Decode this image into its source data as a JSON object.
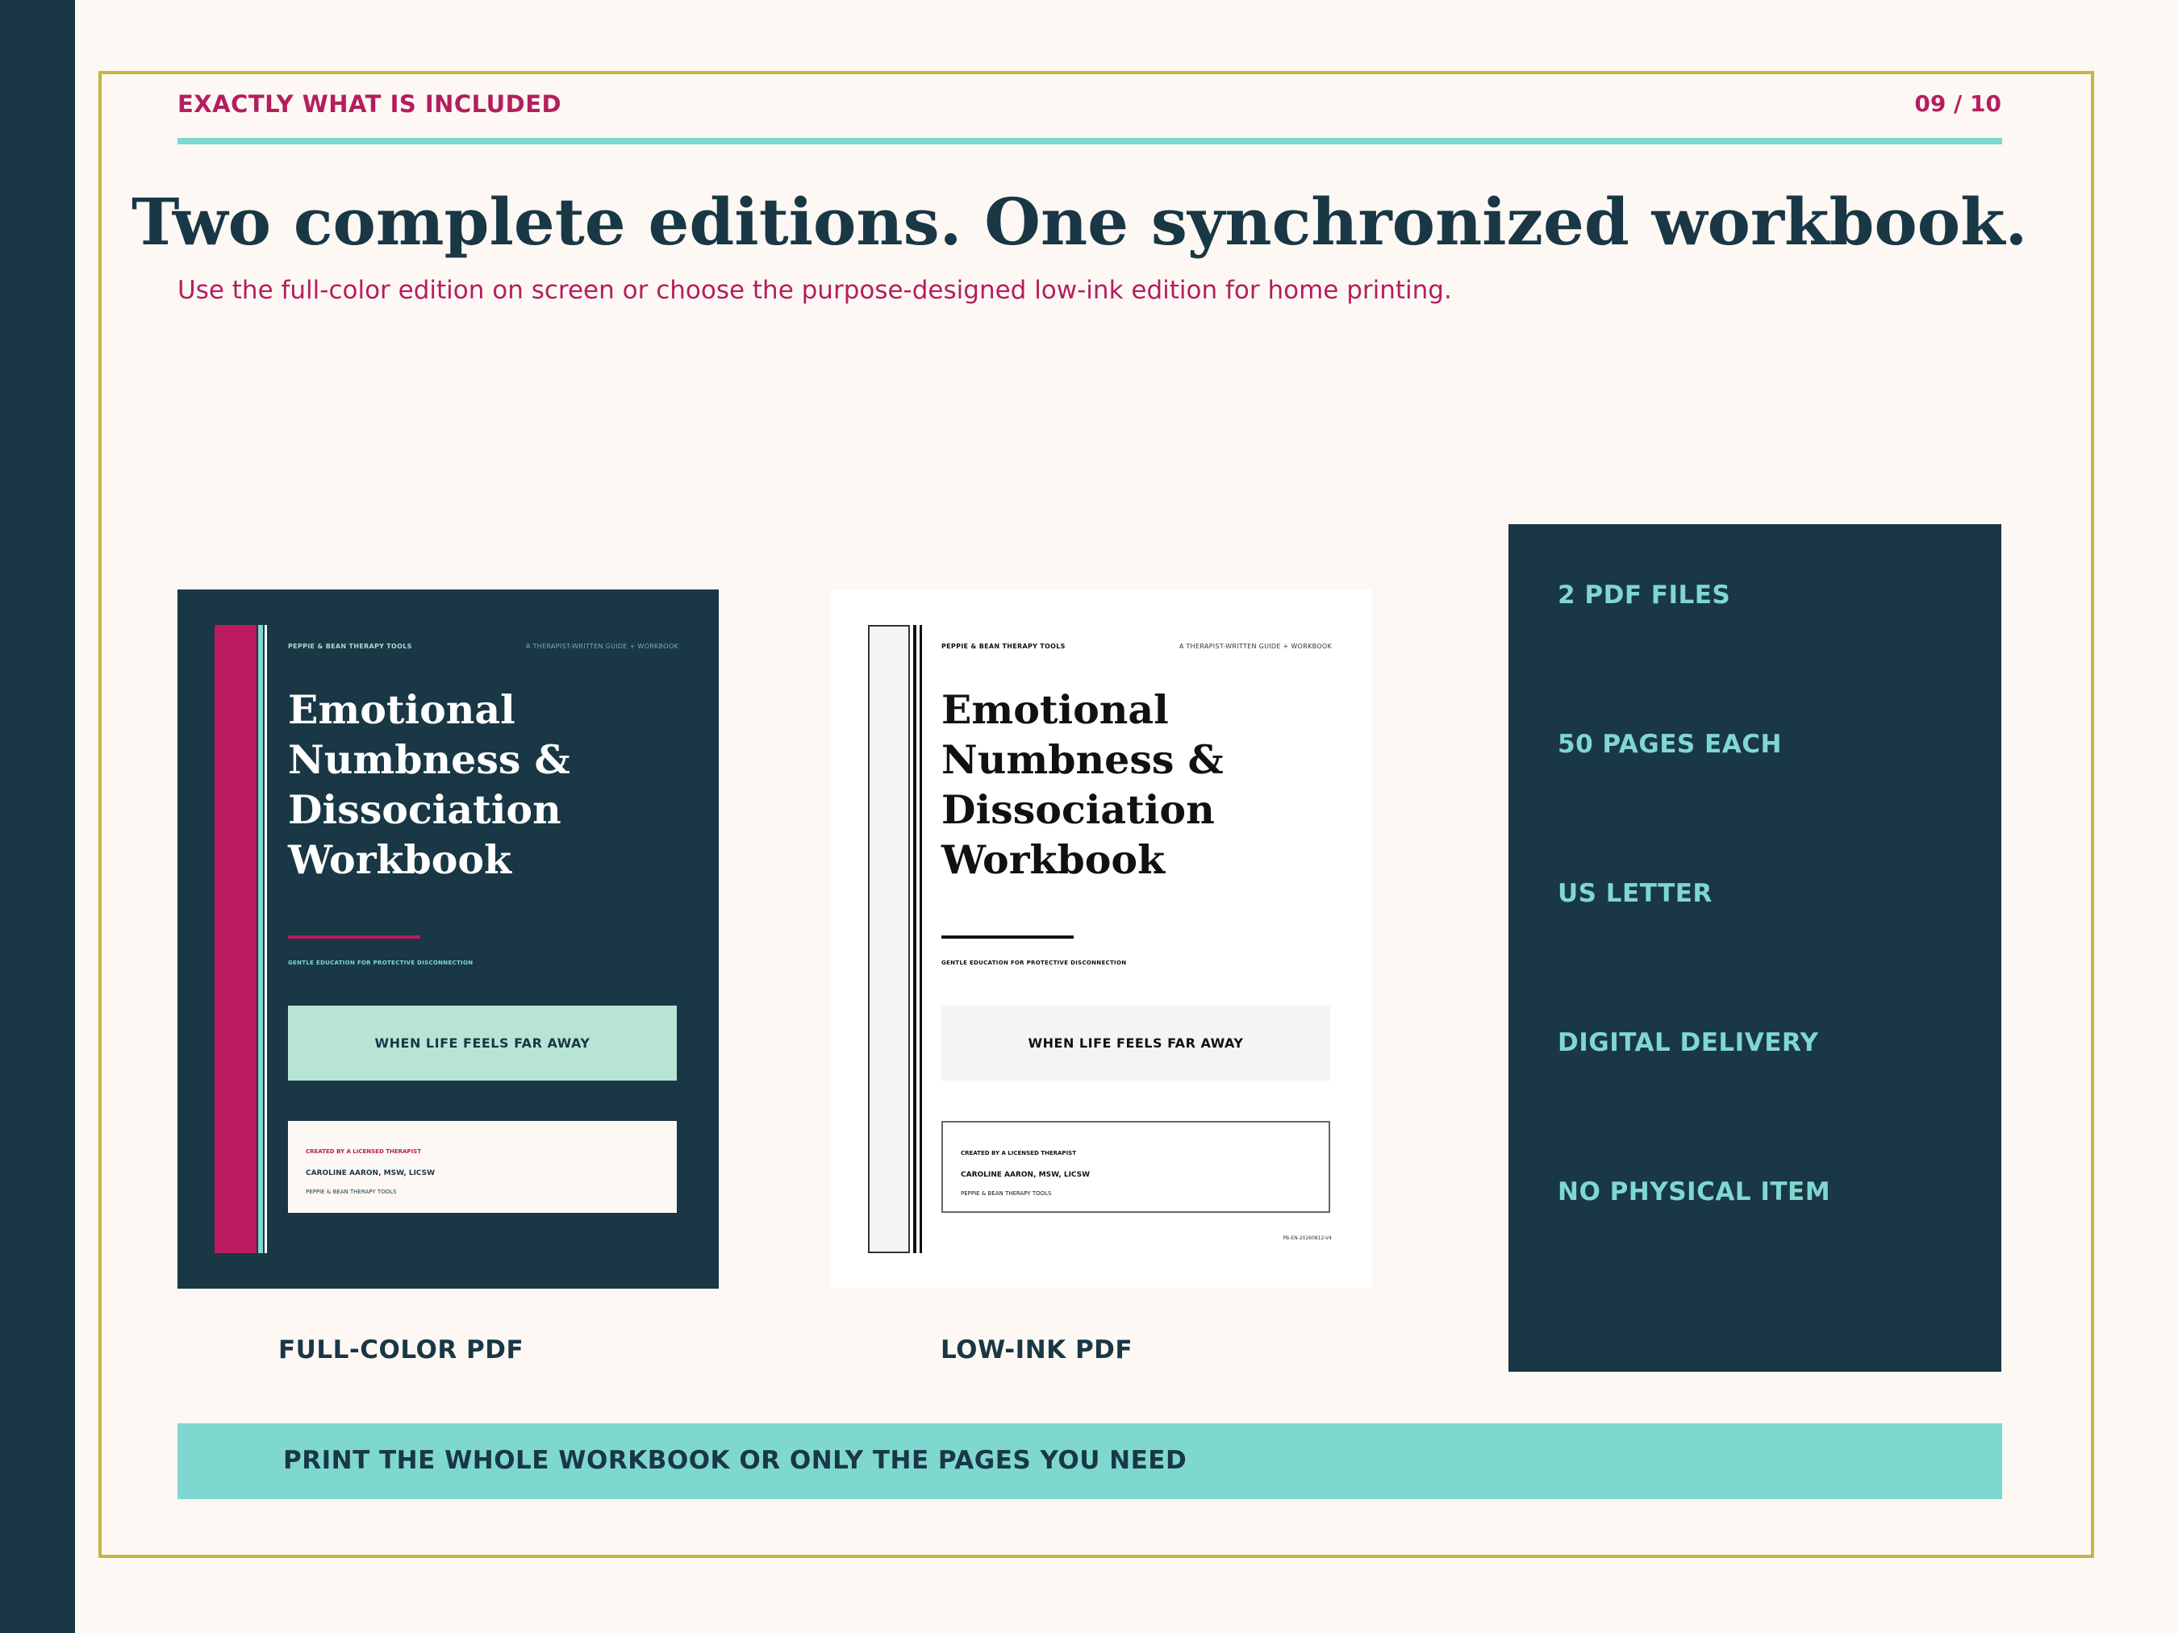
{
  "header": {
    "section_label": "EXACTLY WHAT IS INCLUDED",
    "page_number": "09 / 10"
  },
  "title": "Two complete editions. One synchronized workbook.",
  "subtitle": "Use the full-color edition on screen or choose the purpose-designed low-ink edition for home printing.",
  "cover": {
    "brand": "PEPPIE & BEAN THERAPY TOOLS",
    "series": "A THERAPIST-WRITTEN GUIDE + WORKBOOK",
    "title_lines": [
      "Emotional",
      "Numbness &",
      "Dissociation",
      "Workbook"
    ],
    "tagline": "GENTLE EDUCATION FOR PROTECTIVE DISCONNECTION",
    "banner": "WHEN LIFE FEELS FAR AWAY",
    "author_heading": "CREATED BY A LICENSED THERAPIST",
    "author_name": "CAROLINE AARON, MSW, LICSW",
    "author_org": "PEPPIE & BEAN THERAPY TOOLS",
    "code": "PB-EN-20260812-V4"
  },
  "editions": {
    "full_color_label": "FULL-COLOR PDF",
    "low_ink_label": "LOW-INK PDF"
  },
  "specs": [
    "2 PDF FILES",
    "50 PAGES EACH",
    "US LETTER",
    "DIGITAL DELIVERY",
    "NO PHYSICAL ITEM"
  ],
  "footer": "PRINT THE WHOLE WORKBOOK OR ONLY THE PAGES YOU NEED",
  "colors": {
    "navy": "#193744",
    "magenta": "#b51e5e",
    "teal": "#7fd8d0",
    "gold": "#c9b343",
    "cream": "#fdf8f4"
  }
}
